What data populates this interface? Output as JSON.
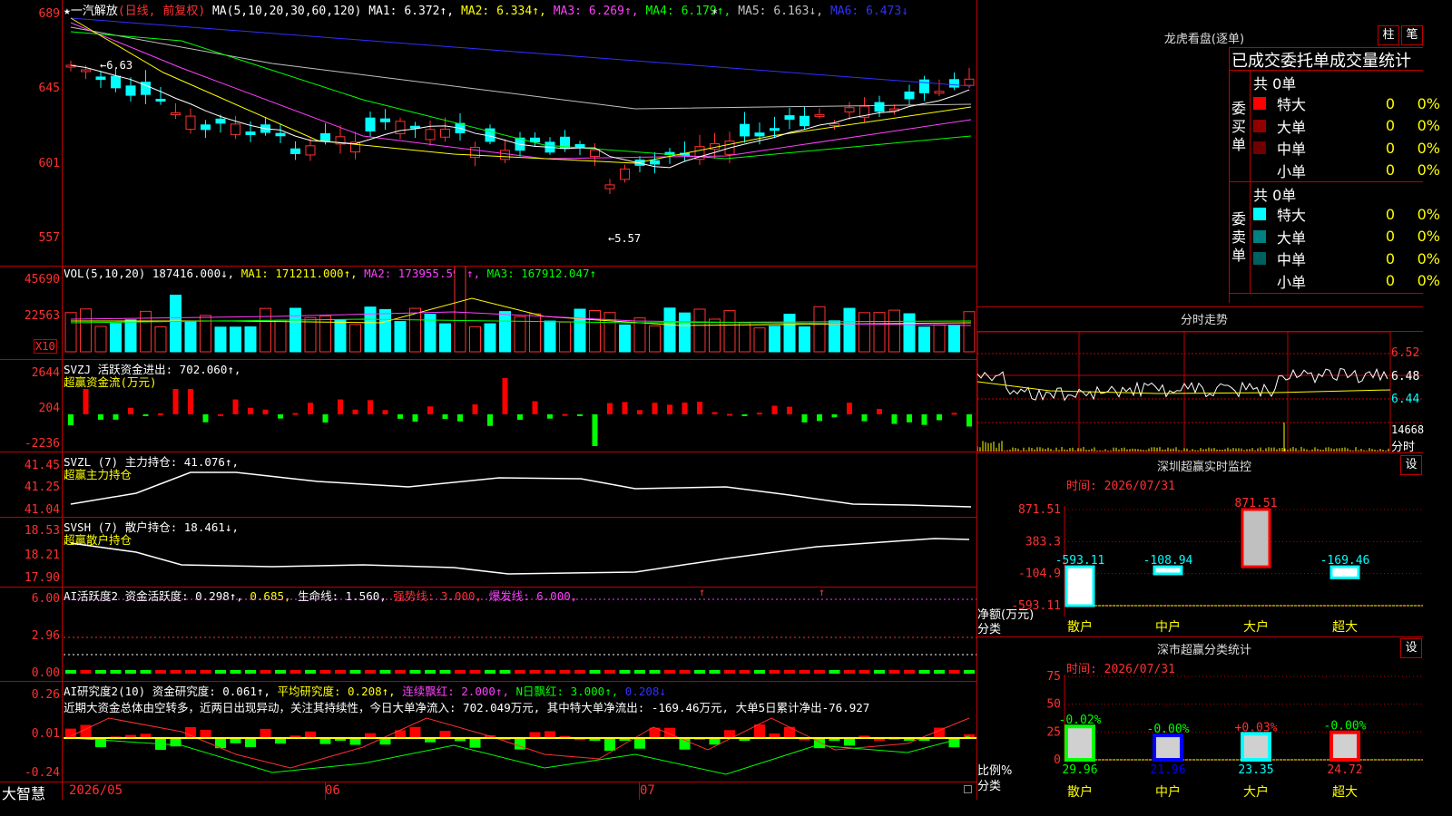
{
  "main": {
    "stock_name": "一汽解放",
    "period": "(日线, 前复权)",
    "ma_label": "MA(5,10,20,30,60,120)",
    "ma1": "MA1: 6.372↑,",
    "ma2": "MA2: 6.334↑,",
    "ma3": "MA3: 6.269↑,",
    "ma4": "MA4: 6.179↑,",
    "ma5": "MA5: 6.163↓,",
    "ma6": "MA6: 6.473↓",
    "y_labels": [
      "689",
      "645",
      "601",
      "557"
    ],
    "high_marker": "←6.63",
    "low_marker": "←5.57"
  },
  "vol": {
    "label": "VOL(5,10,20)",
    "value": "187416.000↓,",
    "ma1": "MA1: 171211.000↑,",
    "ma2": "MA2: 173955.594↑,",
    "ma3": "MA3: 167912.047↑",
    "y_labels": [
      "45690",
      "22563"
    ],
    "x10": "X10"
  },
  "svzj": {
    "label": "SVZJ  活跃资金进出: 702.060↑,",
    "sub": "超赢资金流(万元)",
    "y_labels": [
      "2644",
      "204",
      "-2236"
    ]
  },
  "svzl": {
    "label": "SVZL (7) 主力持仓: 41.076↑,",
    "sub": "超赢主力持仓",
    "y_labels": [
      "41.45",
      "41.25",
      "41.04"
    ]
  },
  "svsh": {
    "label": "SVSH (7) 散户持仓: 18.461↓,",
    "sub": "超赢散户持仓",
    "y_labels": [
      "18.53",
      "18.21",
      "17.90"
    ]
  },
  "ai1": {
    "a": "AI活跃度2 资金活跃度: 0.298↑,",
    "b": "0.685,",
    "c": "生命线: 1.560,",
    "d": "强势线: 3.000,",
    "e": "爆发线: 6.000,",
    "y_labels": [
      "6.00",
      "2.96",
      "0.00"
    ]
  },
  "ai2": {
    "a": "AI研究度2(10) 资金研究度: 0.061↑,",
    "b": "平均研究度: 0.208↑,",
    "c": "连续飘红: 2.000↑,",
    "d": "N日飘红: 3.000↑,",
    "e": "0.208↓",
    "commentary": "近期大资金总体由空转多，近两日出现异动，关注其持续性，今日大单净流入: 702.049万元, 其中特大单净流出: -169.46万元, 大单5日累计净出-76.927",
    "y_labels": [
      "0.26",
      "0.01",
      "-0.24"
    ]
  },
  "bottom": {
    "brand": "大智慧",
    "dates": [
      "2026/05",
      "06",
      "07"
    ]
  },
  "right": {
    "dragon_title": "龙虎看盘(逐单)",
    "btn_zhu": "柱",
    "btn_bi": "笔",
    "stats_title": "已成交委托单成交量统计",
    "buy_label": "委买单",
    "sell_label": "委卖单",
    "total_buy": "共 0单",
    "total_sell": "共 0单",
    "buy_rows": [
      {
        "name": "特大",
        "n": "0",
        "p": "0%",
        "color": "#ff0000"
      },
      {
        "name": "大单",
        "n": "0",
        "p": "0%",
        "color": "#900000"
      },
      {
        "name": "中单",
        "n": "0",
        "p": "0%",
        "color": "#700000"
      },
      {
        "name": "小单",
        "n": "0",
        "p": "0%",
        "color": "#000000"
      }
    ],
    "sell_rows": [
      {
        "name": "特大",
        "n": "0",
        "p": "0%",
        "color": "#00ffff"
      },
      {
        "name": "大单",
        "n": "0",
        "p": "0%",
        "color": "#008080"
      },
      {
        "name": "中单",
        "n": "0",
        "p": "0%",
        "color": "#006060"
      },
      {
        "name": "小单",
        "n": "0",
        "p": "0%",
        "color": "#000000"
      }
    ],
    "intraday_title": "分时走势",
    "intraday_prices": [
      "6.52",
      "6.48",
      "6.44"
    ],
    "intraday_vol": "14668",
    "intraday_vol_unit": "分时",
    "monitor_title": "深圳超赢实时监控",
    "set_btn": "设",
    "monitor_time": "时间: 2026/07/31",
    "monitor_axis": [
      "871.51",
      "383.3",
      "-104.9",
      "-593.11"
    ],
    "monitor_ylabel": "净额(万元)",
    "monitor_xlabel": "分类",
    "monitor_values": [
      "-593.11",
      "-108.94",
      "871.51",
      "-169.46"
    ],
    "monitor_cats": [
      "散户",
      "中户",
      "大户",
      "超大"
    ],
    "class_title": "深市超赢分类统计",
    "class_time": "时间: 2026/07/31",
    "class_axis": [
      "75",
      "50",
      "25",
      "0"
    ],
    "class_ylabel": "比例%",
    "class_xlabel": "分类",
    "class_changes": [
      "-0.02%",
      "-0.00%",
      "+0.03%",
      "-0.00%"
    ],
    "class_values": [
      "29.96",
      "21.96",
      "23.35",
      "24.72"
    ],
    "class_cats": [
      "散户",
      "中户",
      "大户",
      "超大"
    ]
  },
  "colors": {
    "up": "#ff3030",
    "down": "#00ffff",
    "grid": "#c00000"
  }
}
